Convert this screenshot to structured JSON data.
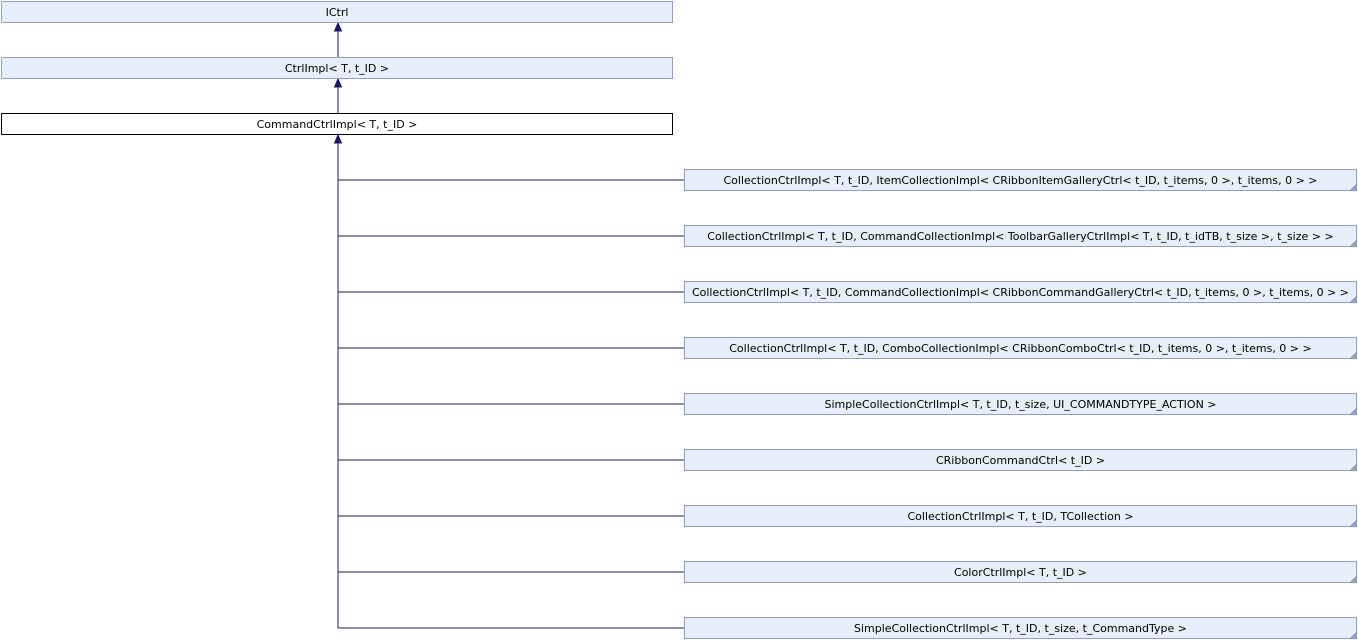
{
  "diagram": {
    "nodes": [
      {
        "id": "ictrl",
        "label": "ICtrl",
        "style": "normal",
        "folded": false
      },
      {
        "id": "ctrlimpl",
        "label": "CtrlImpl< T, t_ID >",
        "style": "normal",
        "folded": false
      },
      {
        "id": "commandctrlimpl",
        "label": "CommandCtrlImpl< T, t_ID >",
        "style": "current",
        "folded": false
      },
      {
        "id": "c1",
        "label": "CollectionCtrlImpl< T, t_ID, ItemCollectionImpl< CRibbonItemGalleryCtrl< t_ID, t_items, 0 >, t_items, 0 > >",
        "style": "normal",
        "folded": true
      },
      {
        "id": "c2",
        "label": "CollectionCtrlImpl< T, t_ID, CommandCollectionImpl< ToolbarGalleryCtrlImpl< T, t_ID, t_idTB, t_size >, t_size > >",
        "style": "normal",
        "folded": true
      },
      {
        "id": "c3",
        "label": "CollectionCtrlImpl< T, t_ID, CommandCollectionImpl< CRibbonCommandGalleryCtrl< t_ID, t_items, 0 >, t_items, 0 > >",
        "style": "normal",
        "folded": true
      },
      {
        "id": "c4",
        "label": "CollectionCtrlImpl< T, t_ID, ComboCollectionImpl< CRibbonComboCtrl< t_ID, t_items, 0 >, t_items, 0 > >",
        "style": "normal",
        "folded": true
      },
      {
        "id": "c5",
        "label": "SimpleCollectionCtrlImpl< T, t_ID, t_size, UI_COMMANDTYPE_ACTION >",
        "style": "normal",
        "folded": true
      },
      {
        "id": "c6",
        "label": "CRibbonCommandCtrl< t_ID >",
        "style": "normal",
        "folded": true
      },
      {
        "id": "c7",
        "label": "CollectionCtrlImpl< T, t_ID, TCollection >",
        "style": "normal",
        "folded": true
      },
      {
        "id": "c8",
        "label": "ColorCtrlImpl< T, t_ID >",
        "style": "normal",
        "folded": true
      },
      {
        "id": "c9",
        "label": "SimpleCollectionCtrlImpl< T, t_ID, t_size, t_CommandType >",
        "style": "normal",
        "folded": true
      }
    ],
    "edges": [
      {
        "from": "ctrlimpl",
        "to": "ictrl"
      },
      {
        "from": "commandctrlimpl",
        "to": "ctrlimpl"
      },
      {
        "from": "c1",
        "to": "commandctrlimpl"
      },
      {
        "from": "c2",
        "to": "commandctrlimpl"
      },
      {
        "from": "c3",
        "to": "commandctrlimpl"
      },
      {
        "from": "c4",
        "to": "commandctrlimpl"
      },
      {
        "from": "c5",
        "to": "commandctrlimpl"
      },
      {
        "from": "c6",
        "to": "commandctrlimpl"
      },
      {
        "from": "c7",
        "to": "commandctrlimpl"
      },
      {
        "from": "c8",
        "to": "commandctrlimpl"
      },
      {
        "from": "c9",
        "to": "commandctrlimpl"
      }
    ]
  }
}
